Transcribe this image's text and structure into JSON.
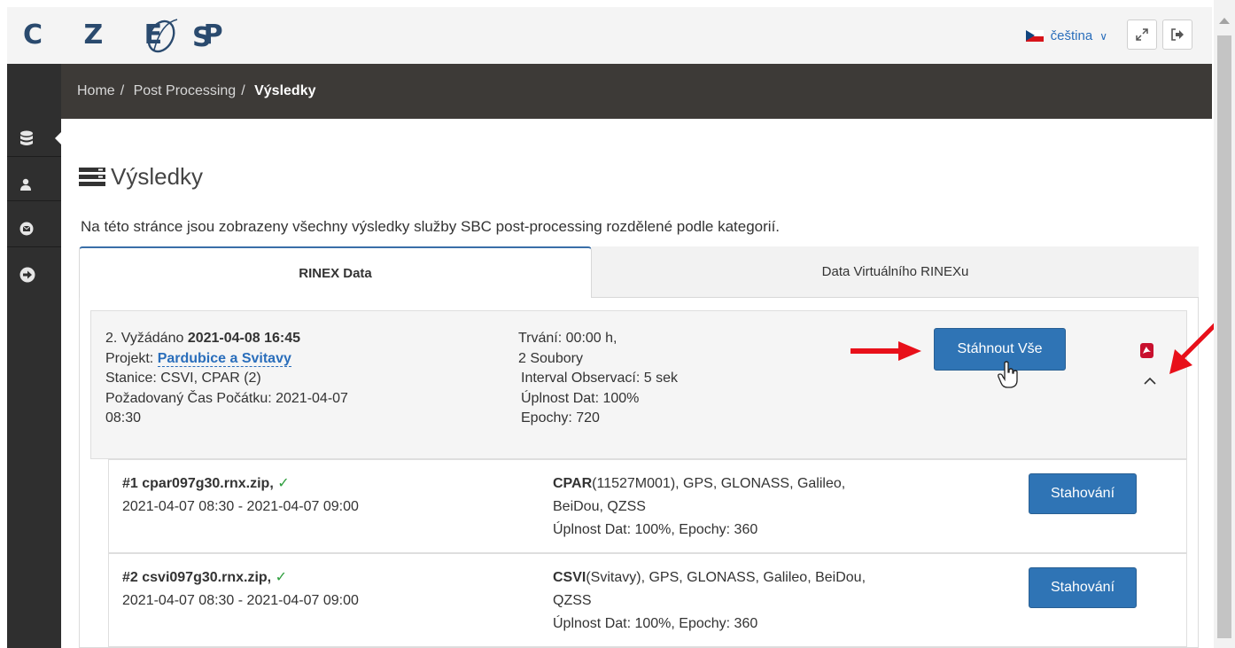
{
  "header": {
    "logo_text": "CZEPOS",
    "language_label": "čeština",
    "language_chevron": "∨"
  },
  "icons": {
    "expand": "expand-icon",
    "logout": "logout-icon",
    "database": "database-icon",
    "user": "user-icon",
    "mail": "mail-icon",
    "arrow_circle": "arrow-circle-icon",
    "list": "list-icon",
    "pdf": "pdf-icon",
    "chevron_up": "chevron-up-icon",
    "check": "check-icon",
    "cursor": "hand-pointer-icon"
  },
  "breadcrumb": {
    "items": [
      "Home",
      "Post Processing"
    ],
    "current": "Výsledky",
    "separator": "/"
  },
  "page": {
    "title": "Výsledky",
    "intro": "Na této stránce jsou zobrazeny všechny výsledky služby SBC post-processing rozdělené podle kategorií."
  },
  "tabs": [
    {
      "label": "RINEX Data",
      "active": true
    },
    {
      "label": "Data Virtuálního RINEXu",
      "active": false
    }
  ],
  "request": {
    "requested_prefix": "2. Vyžádáno ",
    "requested_date": "2021-04-08 16:45",
    "project_label": "Projekt: ",
    "project_name": "Pardubice a Svitavy",
    "stations": "Stanice: CSVI, CPAR (2)",
    "start_time_line1": "Požadovaný Čas Počátku: 2021-04-07",
    "start_time_line2": "08:30",
    "duration": "Trvání: 00:00 h,",
    "files": "2 Soubory",
    "interval": "Interval Observací: 5 sek",
    "completeness": "Úplnost Dat: 100%",
    "epochs": "Epochy: 720",
    "download_all_label": "Stáhnout Vše"
  },
  "files": [
    {
      "name": "#1 cpar097g30.rnx.zip,",
      "check": "✓",
      "range": "2021-04-07 08:30 - 2021-04-07 09:00",
      "station": "CPAR",
      "systems_line1": "(11527M001), GPS, GLONASS, Galileo,",
      "systems_line2": "BeiDou, QZSS",
      "stats": "Úplnost Dat: 100%, Epochy: 360",
      "button_label": "Stahování"
    },
    {
      "name": "#2 csvi097g30.rnx.zip,",
      "check": "✓",
      "range": "2021-04-07 08:30 - 2021-04-07 09:00",
      "station": "CSVI",
      "systems_line1": "(Svitavy), GPS, GLONASS, Galileo, BeiDou,",
      "systems_line2": "QZSS",
      "stats": "Úplnost Dat: 100%, Epochy: 360",
      "button_label": "Stahování"
    }
  ],
  "colors": {
    "brand": "#2a4a6e",
    "primary": "#2f74b5",
    "sidebar": "#2f2f2f",
    "breadcrumb_bar": "#3d3a37",
    "annotation": "#e8101a",
    "success": "#2e9e3e"
  }
}
